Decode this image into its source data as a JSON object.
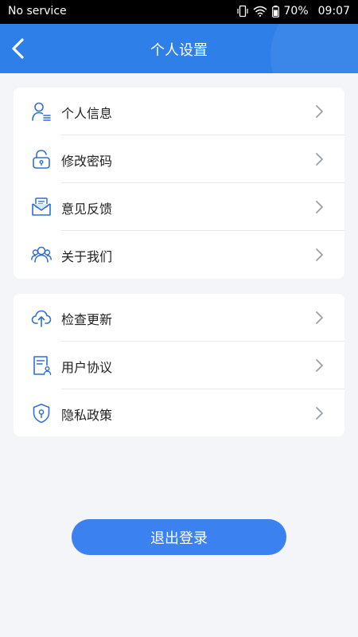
{
  "status_bar": {
    "carrier": "No service",
    "battery": "70%",
    "time": "09:07"
  },
  "header": {
    "title": "个人设置"
  },
  "group1": {
    "items": [
      {
        "label": "个人信息",
        "icon": "user-info-icon"
      },
      {
        "label": "修改密码",
        "icon": "lock-icon"
      },
      {
        "label": "意见反馈",
        "icon": "feedback-mail-icon"
      },
      {
        "label": "关于我们",
        "icon": "group-users-icon"
      }
    ]
  },
  "group2": {
    "items": [
      {
        "label": "检查更新",
        "icon": "cloud-upload-icon"
      },
      {
        "label": "用户协议",
        "icon": "document-user-icon"
      },
      {
        "label": "隐私政策",
        "icon": "shield-icon"
      }
    ]
  },
  "logout_label": "退出登录",
  "colors": {
    "accent": "#2f7fe8",
    "button": "#3b82f0",
    "icon": "#2f6fd6",
    "background": "#f3f5f9"
  }
}
